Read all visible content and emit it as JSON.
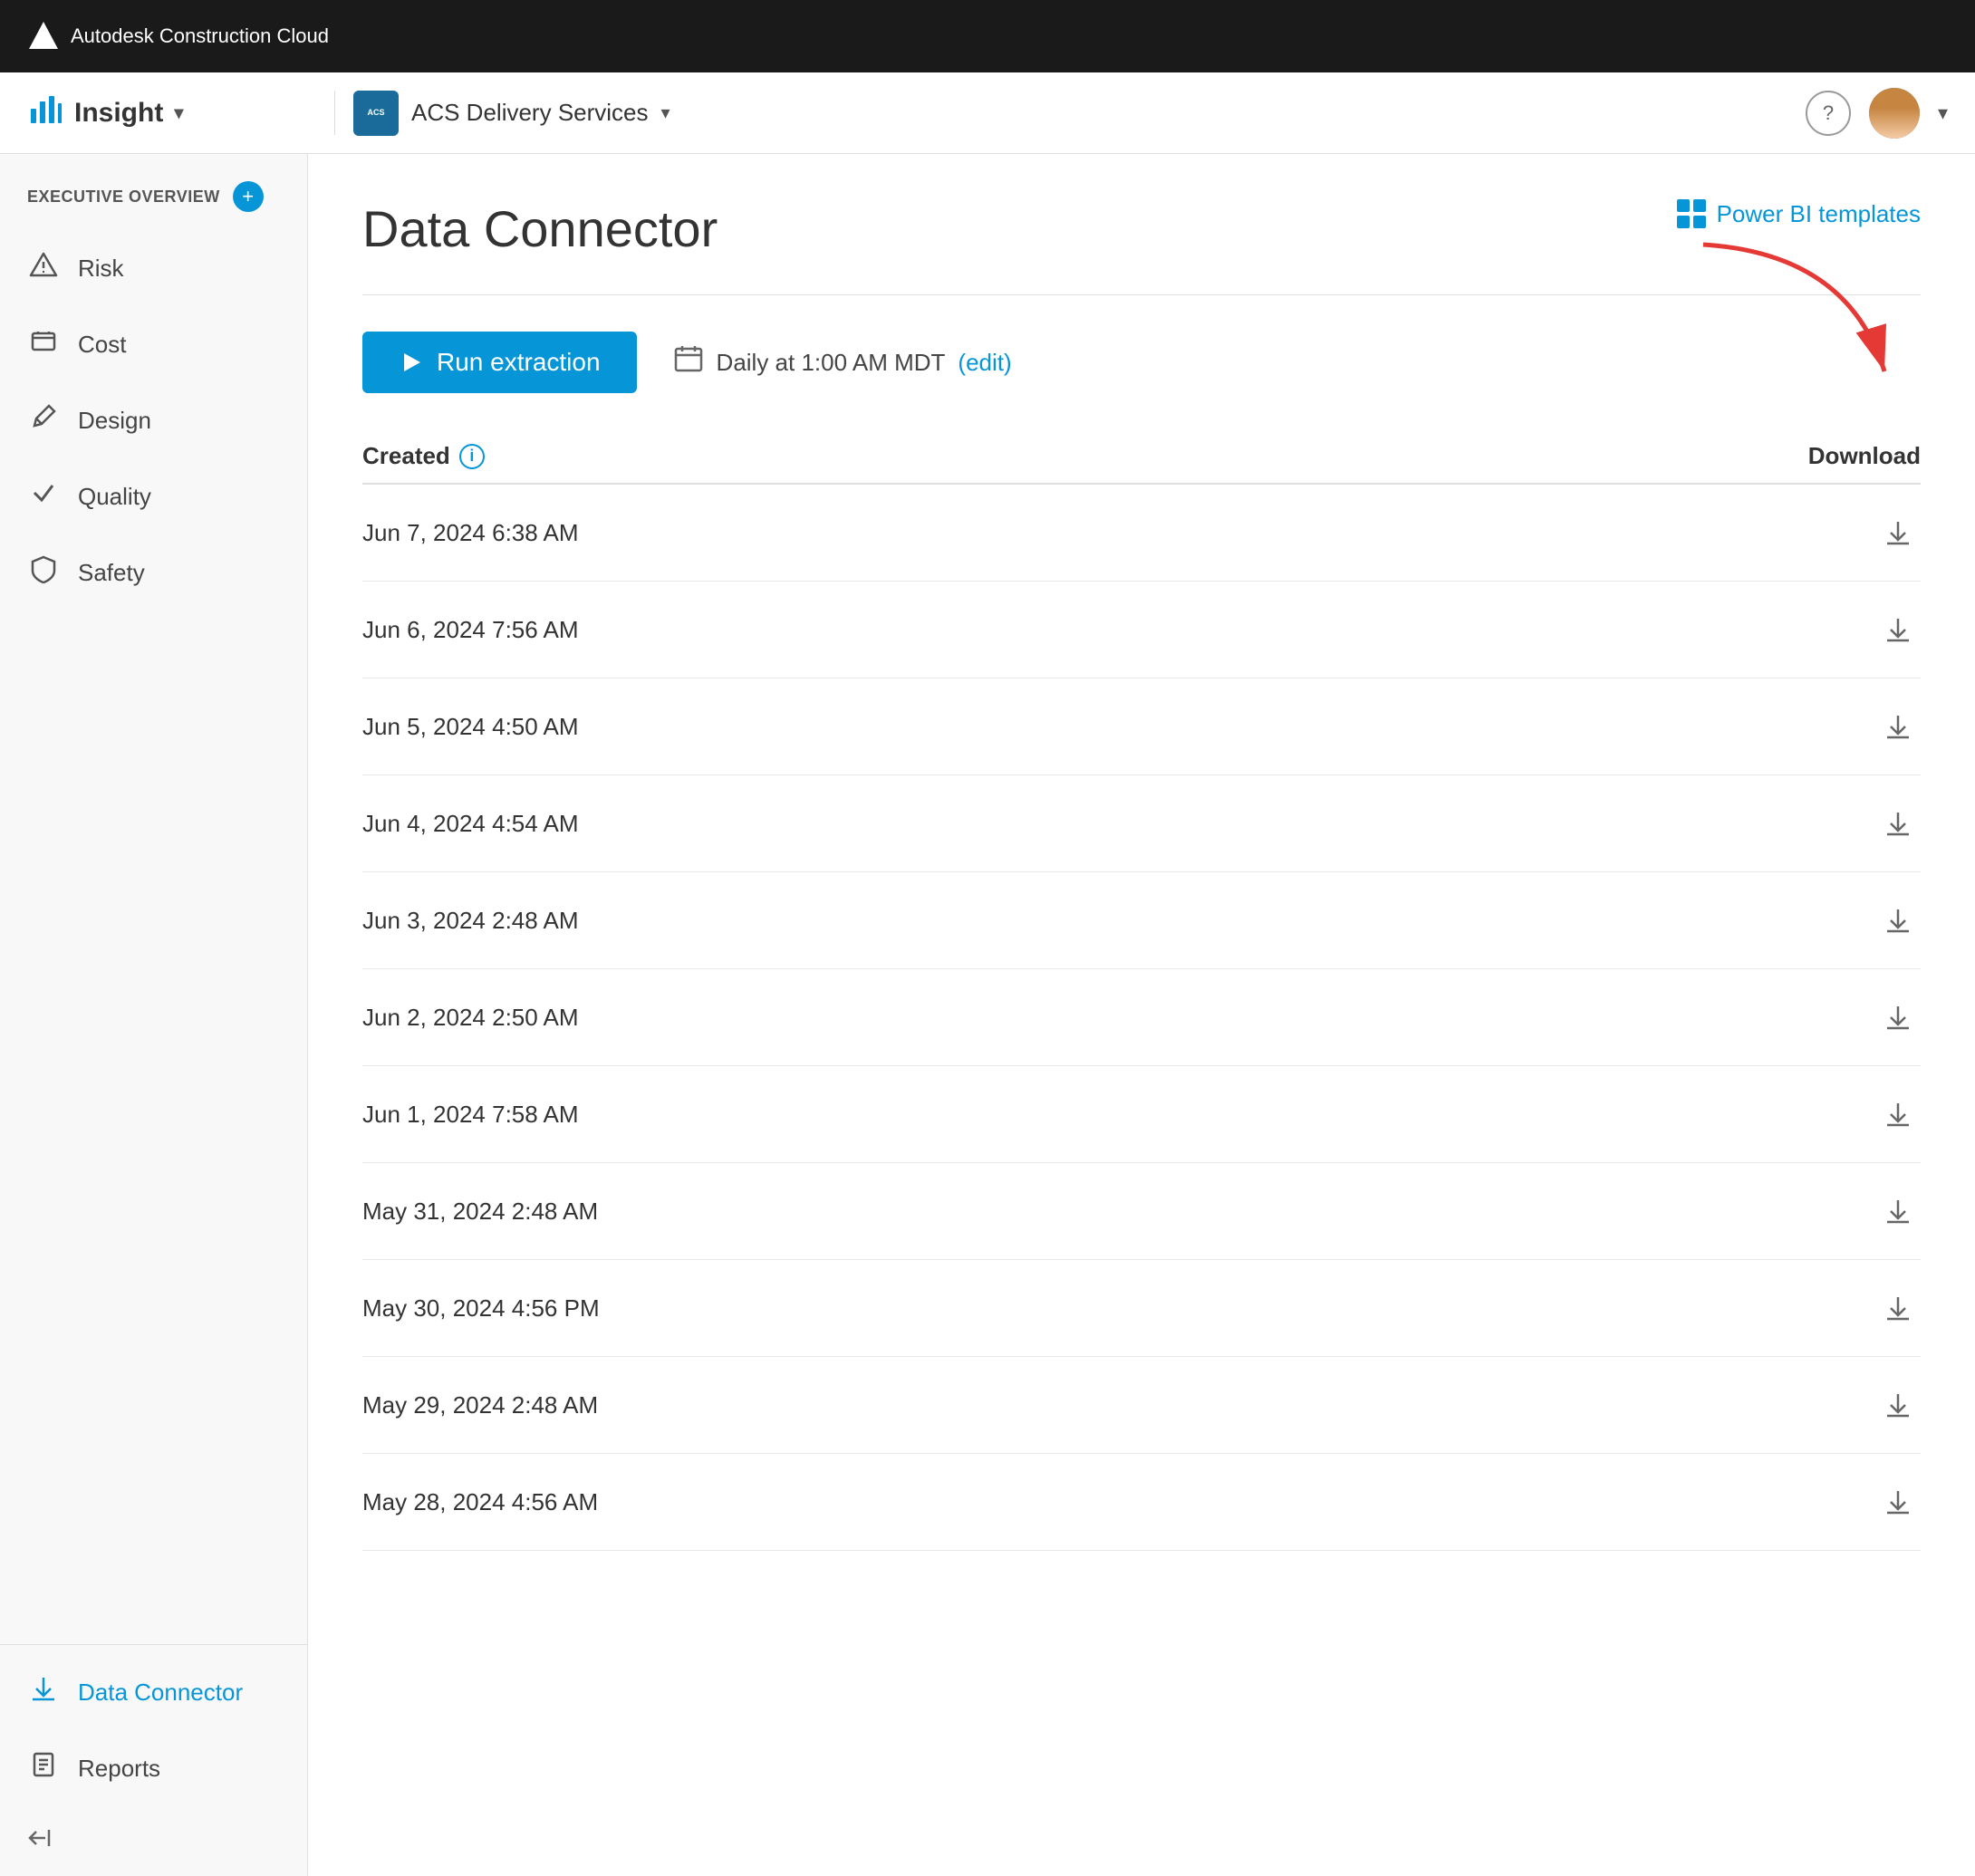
{
  "topbar": {
    "brand": "Autodesk Construction Cloud"
  },
  "header": {
    "app_name": "Insight",
    "app_dropdown": "▾",
    "project_name": "ACS Delivery Services",
    "project_dropdown": "▾",
    "help_label": "?",
    "avatar_alt": "User avatar"
  },
  "sidebar": {
    "section_title": "EXECUTIVE OVERVIEW",
    "add_button_label": "+",
    "items": [
      {
        "id": "risk",
        "label": "Risk",
        "icon": "⚠"
      },
      {
        "id": "cost",
        "label": "Cost",
        "icon": "🖥"
      },
      {
        "id": "design",
        "label": "Design",
        "icon": "✏"
      },
      {
        "id": "quality",
        "label": "Quality",
        "icon": "✓"
      },
      {
        "id": "safety",
        "label": "Safety",
        "icon": "⛑"
      }
    ],
    "bottom_items": [
      {
        "id": "data-connector",
        "label": "Data Connector",
        "icon": "⬇",
        "active": true
      },
      {
        "id": "reports",
        "label": "Reports",
        "icon": "📋"
      }
    ],
    "collapse_icon": "←"
  },
  "content": {
    "page_title": "Data Connector",
    "power_bi_link": "Power BI templates",
    "run_button": "Run extraction",
    "schedule_text": "Daily at 1:00 AM MDT",
    "edit_link": "(edit)",
    "table": {
      "col_created": "Created",
      "col_download": "Download",
      "rows": [
        {
          "date": "Jun 7, 2024 6:38 AM"
        },
        {
          "date": "Jun 6, 2024 7:56 AM"
        },
        {
          "date": "Jun 5, 2024 4:50 AM"
        },
        {
          "date": "Jun 4, 2024 4:54 AM"
        },
        {
          "date": "Jun 3, 2024 2:48 AM"
        },
        {
          "date": "Jun 2, 2024 2:50 AM"
        },
        {
          "date": "Jun 1, 2024 7:58 AM"
        },
        {
          "date": "May 31, 2024 2:48 AM"
        },
        {
          "date": "May 30, 2024 4:56 PM"
        },
        {
          "date": "May 29, 2024 2:48 AM"
        },
        {
          "date": "May 28, 2024 4:56 AM"
        }
      ]
    }
  }
}
